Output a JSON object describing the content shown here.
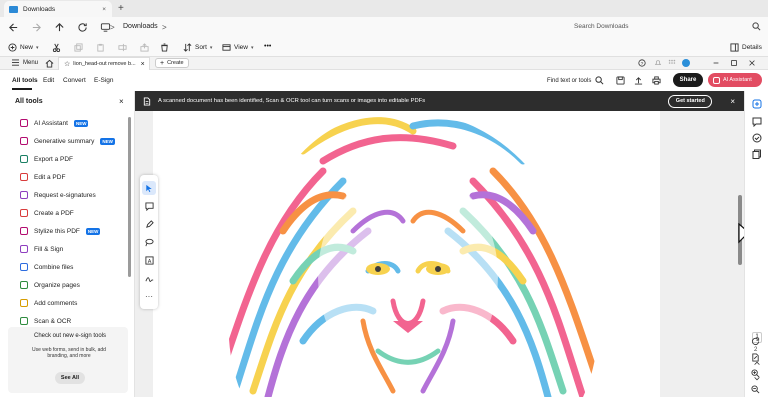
{
  "explorer": {
    "tab_title": "Downloads",
    "new_tab_symbol": "+",
    "breadcrumb_separator": ">",
    "location": "Downloads",
    "location_chevron": ">",
    "search_placeholder": "Search Downloads",
    "commands": {
      "new": "New",
      "sort": "Sort",
      "view": "View",
      "more": "•••",
      "details": "Details"
    }
  },
  "acrobat": {
    "title_menu": "Menu",
    "tab_title": "lion_head-out remove b...",
    "create_label": "Create",
    "menu_tabs": [
      "All tools",
      "Edit",
      "Convert",
      "E-Sign"
    ],
    "find_label": "Find text or tools",
    "share_label": "Share",
    "ai_assistant_label": "AI Assistant",
    "banner_text": "A scanned document has been identified, Scan & OCR tool can turn scans or images into editable PDFs",
    "banner_button": "Get started",
    "panel_title": "All tools",
    "new_badge": "NEW",
    "tools": [
      {
        "label": "AI Assistant",
        "icon": "ai-assistant-icon",
        "color": "#b30b6f",
        "badge": true
      },
      {
        "label": "Generative summary",
        "icon": "generative-summary-icon",
        "color": "#b30b6f",
        "badge": true
      },
      {
        "label": "Export a PDF",
        "icon": "export-pdf-icon",
        "color": "#1a7f64",
        "badge": false
      },
      {
        "label": "Edit a PDF",
        "icon": "edit-pdf-icon",
        "color": "#d83b3b",
        "badge": false
      },
      {
        "label": "Request e-signatures",
        "icon": "request-signature-icon",
        "color": "#8e3fbf",
        "badge": false
      },
      {
        "label": "Create a PDF",
        "icon": "create-pdf-icon",
        "color": "#d83b3b",
        "badge": false
      },
      {
        "label": "Stylize this PDF",
        "icon": "stylize-pdf-icon",
        "color": "#b30b6f",
        "badge": true
      },
      {
        "label": "Fill & Sign",
        "icon": "fill-sign-icon",
        "color": "#8e3fbf",
        "badge": false
      },
      {
        "label": "Combine files",
        "icon": "combine-files-icon",
        "color": "#2d6cdf",
        "badge": false
      },
      {
        "label": "Organize pages",
        "icon": "organize-pages-icon",
        "color": "#2e8b3e",
        "badge": false
      },
      {
        "label": "Add comments",
        "icon": "add-comments-icon",
        "color": "#d69c00",
        "badge": false
      },
      {
        "label": "Scan & OCR",
        "icon": "scan-ocr-icon",
        "color": "#2e8b3e",
        "badge": false
      }
    ],
    "promo_title": "Check out new e-sign tools",
    "promo_text": "Use web forms, send in bulk, add branding, and more",
    "promo_button": "See All",
    "page_number": "1",
    "page_total": "2"
  }
}
